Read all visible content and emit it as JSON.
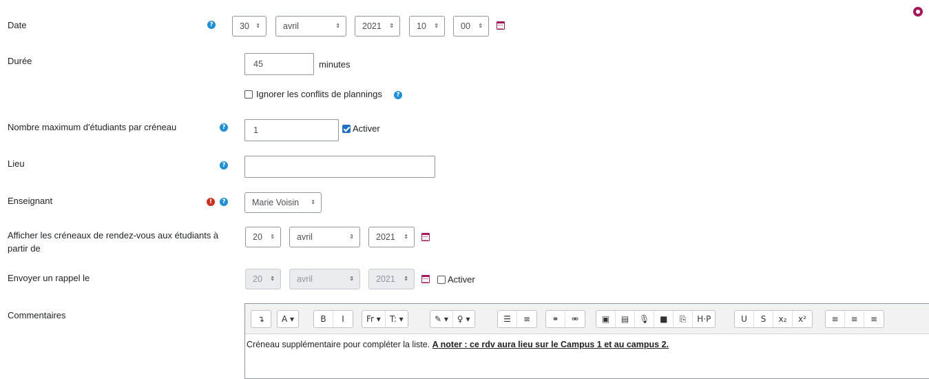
{
  "fields": {
    "date": {
      "label": "Date",
      "day": "30",
      "month": "avril",
      "year": "2021",
      "hour": "10",
      "minute": "00"
    },
    "duration": {
      "label": "Durée",
      "value": "45",
      "unit": "minutes",
      "ignore_conflicts_label": "Ignorer les conflits de plannings",
      "ignore_conflicts_checked": false
    },
    "max_students": {
      "label": "Nombre maximum d'étudiants par créneau",
      "value": "1",
      "activate_label": "Activer",
      "activate_checked": true
    },
    "location": {
      "label": "Lieu",
      "value": ""
    },
    "teacher": {
      "label": "Enseignant",
      "value": "Marie Voisin"
    },
    "display_from": {
      "label": "Afficher les créneaux de rendez-vous aux étudiants à partir de",
      "day": "20",
      "month": "avril",
      "year": "2021"
    },
    "reminder": {
      "label": "Envoyer un rappel le",
      "day": "20",
      "month": "avril",
      "year": "2021",
      "activate_label": "Activer",
      "activate_checked": false
    },
    "comments": {
      "label": "Commentaires",
      "text_plain": "Créneau supplémentaire pour compléter la liste. ",
      "text_strong": "A noter : ce rdv aura lieu sur le Campus 1 et au campus 2."
    }
  },
  "icons": {
    "help": "?",
    "error": "!",
    "select_arrow": "⇕",
    "accent_color": "#a3195b",
    "help_color": "#1f8fd6"
  },
  "toolbar": {
    "groups": [
      [
        "↴"
      ],
      [
        "A ▾"
      ],
      [
        "B",
        "I"
      ],
      [
        "Fr ▾",
        "T: ▾"
      ],
      [
        "✎ ▾",
        "♀ ▾"
      ],
      [
        "☰",
        "≡"
      ],
      [
        "⚭",
        "⚮"
      ],
      [
        "▣",
        "▤",
        "🎙",
        "■",
        "⎘",
        "H·P"
      ],
      [
        "U",
        "S",
        "x₂",
        "x²"
      ],
      [
        "≡",
        "≡",
        "≡"
      ]
    ]
  }
}
